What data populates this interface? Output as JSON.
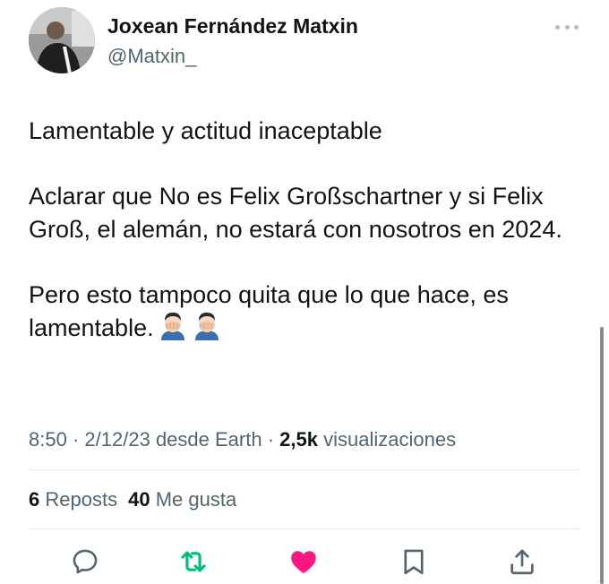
{
  "author": {
    "display_name": "Joxean Fernández Matxin",
    "handle": "@Matxin_"
  },
  "tweet": {
    "paragraphs": [
      "Lamentable y actitud inaceptable",
      "Aclarar que No es Felix Großschartner y si Felix Groß, el alemán, no estará con nosotros en 2024.",
      "Pero esto tampoco quita que lo que hace, es lamentable."
    ],
    "emojis": [
      "face-palm-emoji",
      "face-palm-emoji"
    ]
  },
  "meta": {
    "time": "8:50",
    "date": "2/12/23",
    "source": "desde Earth",
    "views_count": "2,5k",
    "views_label": "visualizaciones"
  },
  "stats": {
    "reposts_count": "6",
    "reposts_label": "Reposts",
    "likes_count": "40",
    "likes_label": "Me gusta"
  },
  "icons": {
    "more": "more-options-icon",
    "reply": "reply-icon",
    "repost": "repost-icon",
    "like": "heart-icon",
    "bookmark": "bookmark-icon",
    "share": "share-icon"
  },
  "colors": {
    "text": "#0f1419",
    "secondary": "#536471",
    "repost_active": "#00ba7c",
    "like_active": "#f91880"
  }
}
